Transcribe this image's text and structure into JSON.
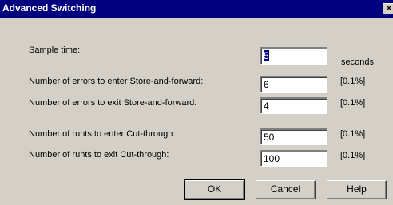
{
  "window": {
    "title": "Advanced Switching",
    "close_glyph": "×"
  },
  "fields": [
    {
      "label": "Sample time:",
      "value": "5",
      "unit": "seconds"
    },
    {
      "label": "Number of errors to enter Store-and-forward:",
      "value": "6",
      "unit": "[0.1%]"
    },
    {
      "label": "Number of errors to exit Store-and-forward:",
      "value": "4",
      "unit": "[0.1%]"
    },
    {
      "label": "Number of runts to enter Cut-through:",
      "value": "50",
      "unit": "[0.1%]"
    },
    {
      "label": "Number of runts to exit Cut-through:",
      "value": "100",
      "unit": "[0.1%]"
    }
  ],
  "buttons": {
    "ok": "OK",
    "cancel": "Cancel",
    "help": "Help"
  }
}
